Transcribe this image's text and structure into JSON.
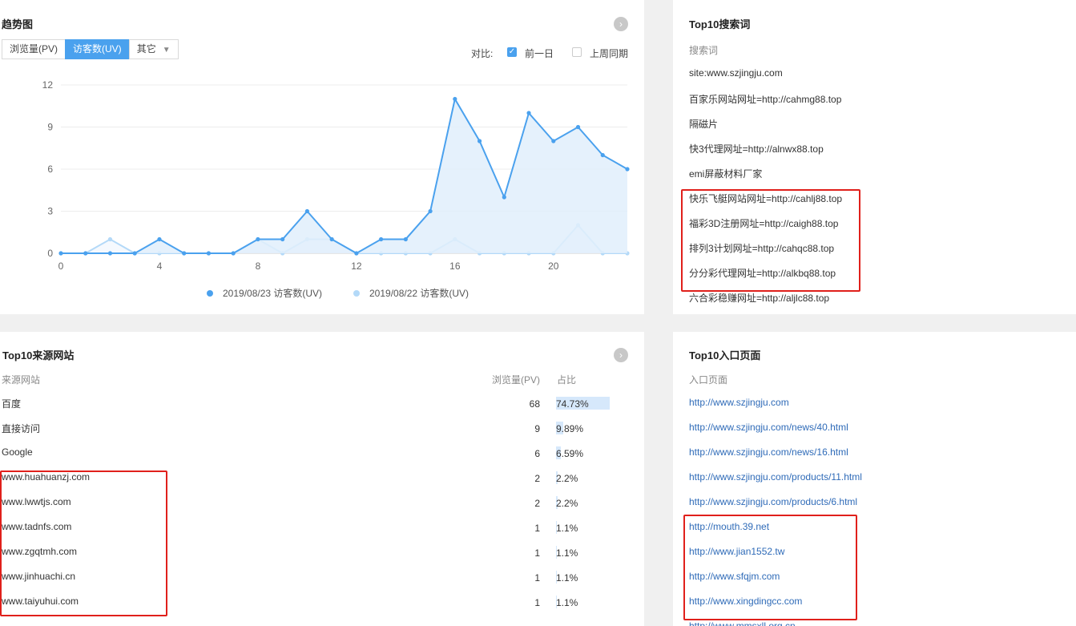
{
  "trend": {
    "title": "趋势图",
    "more_icon": "chevron-right-circle-icon",
    "tabs": [
      {
        "label": "浏览量(PV)",
        "active": false
      },
      {
        "label": "访客数(UV)",
        "active": true
      },
      {
        "label": "其它",
        "active": false
      }
    ],
    "compare": {
      "label": "对比:",
      "options": [
        {
          "label": "前一日",
          "checked": true
        },
        {
          "label": "上周同期",
          "checked": false
        }
      ]
    }
  },
  "chart_data": {
    "type": "area",
    "x": [
      0,
      1,
      2,
      3,
      4,
      5,
      6,
      7,
      8,
      9,
      10,
      11,
      12,
      13,
      14,
      15,
      16,
      17,
      18,
      19,
      20,
      21,
      22,
      23
    ],
    "x_ticks": [
      "0",
      "4",
      "8",
      "12",
      "16",
      "20"
    ],
    "y_ticks": [
      "0",
      "3",
      "6",
      "9",
      "12"
    ],
    "ylim": [
      0,
      12
    ],
    "grid": true,
    "legend_position": "bottom",
    "series": [
      {
        "name": "2019/08/23 访客数(UV)",
        "color": "#4aa1ee",
        "values": [
          0,
          0,
          0,
          0,
          1,
          0,
          0,
          0,
          1,
          1,
          3,
          1,
          0,
          1,
          1,
          3,
          11,
          8,
          4,
          10,
          8,
          9,
          7,
          6
        ]
      },
      {
        "name": "2019/08/22 访客数(UV)",
        "color": "#b3d9f8",
        "values": [
          0,
          0,
          1,
          0,
          0,
          0,
          0,
          0,
          1,
          0,
          1,
          1,
          0,
          0,
          0,
          0,
          1,
          0,
          0,
          0,
          0,
          2,
          0,
          0
        ]
      }
    ]
  },
  "top_search": {
    "title": "Top10搜索词",
    "column": "搜索词",
    "items": [
      "site:www.szjingju.com",
      "百家乐网站网址=http://cahmg88.top",
      "隔磁片",
      "快3代理网址=http://alnwx88.top",
      "emi屏蔽材料厂家",
      "快乐飞艇网站网址=http://cahlj88.top",
      "福彩3D注册网址=http://caigh88.top",
      "排列3计划网址=http://cahqc88.top",
      "分分彩代理网址=http://alkbq88.top",
      "六合彩稳赚网址=http://aljlc88.top"
    ]
  },
  "top_source": {
    "title": "Top10来源网站",
    "more_icon": "chevron-right-circle-icon",
    "columns": {
      "site": "来源网站",
      "pv": "浏览量(PV)",
      "share": "占比"
    },
    "rows": [
      {
        "site": "百度",
        "pv": "68",
        "share": "74.73%",
        "share_value": 74.73
      },
      {
        "site": "直接访问",
        "pv": "9",
        "share": "9.89%",
        "share_value": 9.89
      },
      {
        "site": "Google",
        "pv": "6",
        "share": "6.59%",
        "share_value": 6.59
      },
      {
        "site": "www.huahuanzj.com",
        "pv": "2",
        "share": "2.2%",
        "share_value": 2.2
      },
      {
        "site": "www.lwwtjs.com",
        "pv": "2",
        "share": "2.2%",
        "share_value": 2.2
      },
      {
        "site": "www.tadnfs.com",
        "pv": "1",
        "share": "1.1%",
        "share_value": 1.1
      },
      {
        "site": "www.zgqtmh.com",
        "pv": "1",
        "share": "1.1%",
        "share_value": 1.1
      },
      {
        "site": "www.jinhuachi.cn",
        "pv": "1",
        "share": "1.1%",
        "share_value": 1.1
      },
      {
        "site": "www.taiyuhui.com",
        "pv": "1",
        "share": "1.1%",
        "share_value": 1.1
      }
    ]
  },
  "top_entry": {
    "title": "Top10入口页面",
    "column": "入口页面",
    "items": [
      "http://www.szjingju.com",
      "http://www.szjingju.com/news/40.html",
      "http://www.szjingju.com/news/16.html",
      "http://www.szjingju.com/products/11.html",
      "http://www.szjingju.com/products/6.html",
      "http://mouth.39.net",
      "http://www.jian1552.tw",
      "http://www.sfqjm.com",
      "http://www.xingdingcc.com",
      "http://www.mmsxll.org.cn"
    ]
  }
}
